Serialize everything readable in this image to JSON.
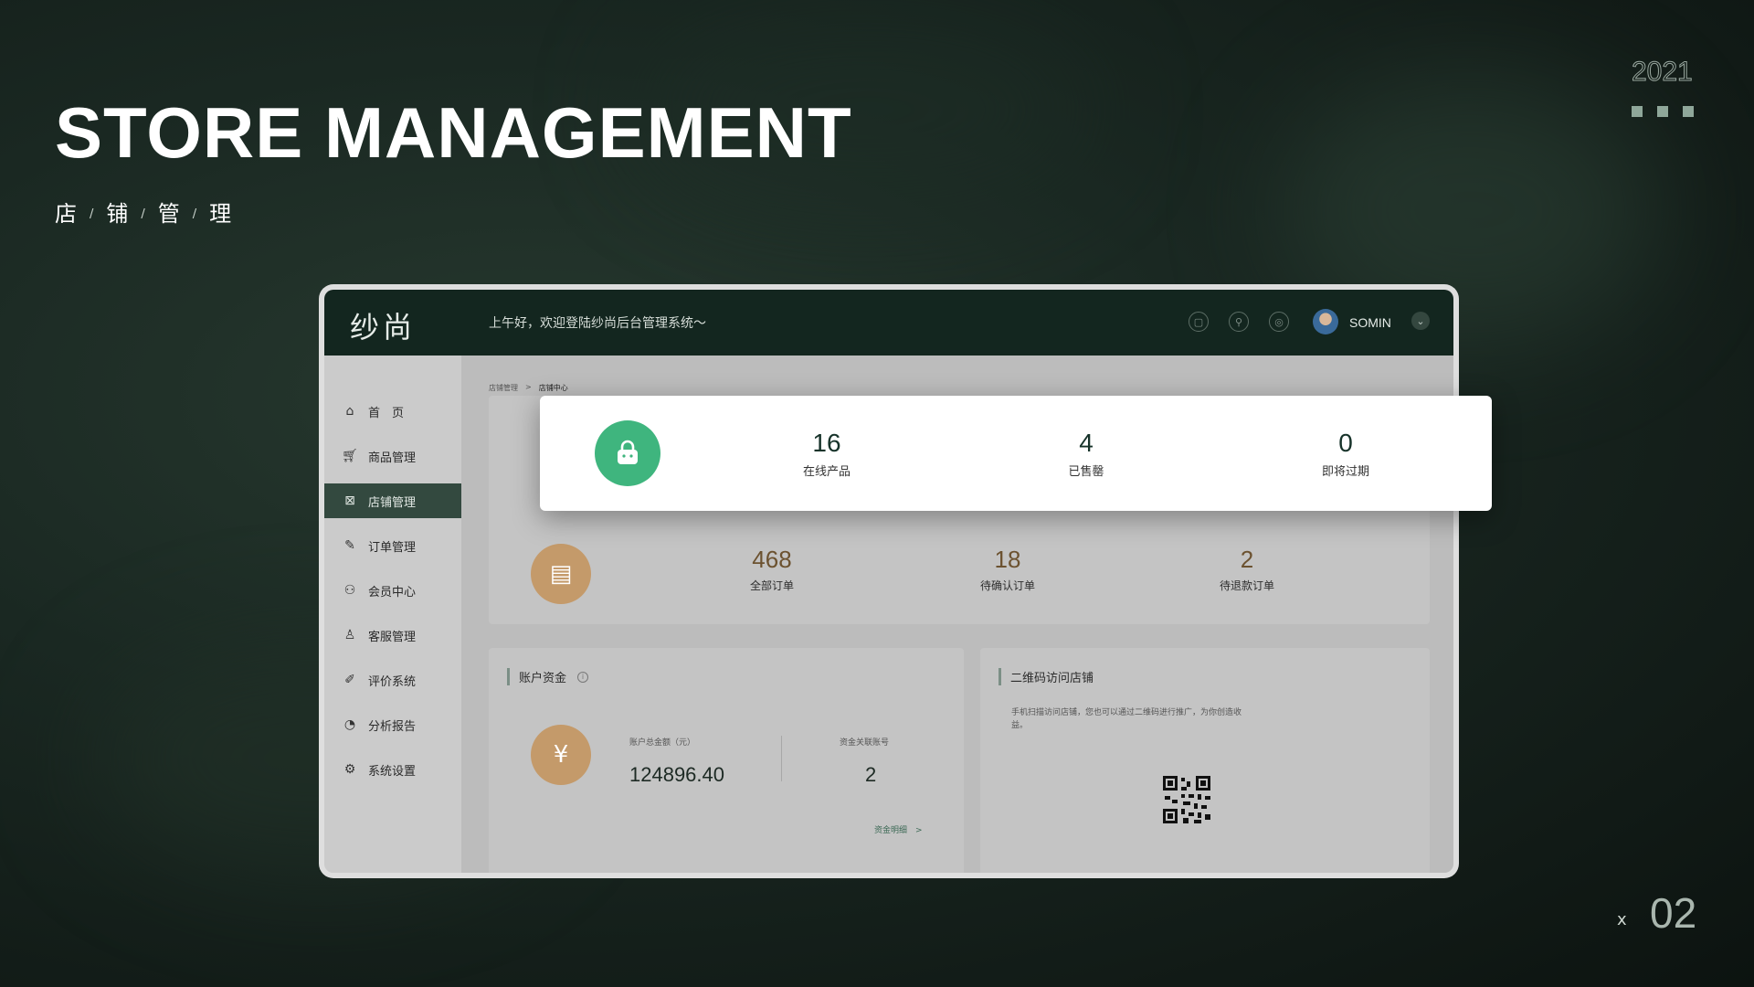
{
  "slide": {
    "title": "STORE MANAGEMENT",
    "subtitle_chars": [
      "店",
      "铺",
      "管",
      "理"
    ],
    "subtitle_sep": "/",
    "year": "2021",
    "page_prefix": "x",
    "page_number": "02"
  },
  "app": {
    "logo": "纱尚",
    "welcome": "上午好，欢迎登陆纱尚后台管理系统～",
    "username": "SOMIN",
    "header_icons": [
      "message-icon",
      "search-icon",
      "settings-icon"
    ]
  },
  "sidebar": {
    "items": [
      {
        "label": "首　页",
        "icon": "home-icon"
      },
      {
        "label": "商品管理",
        "icon": "cart-icon"
      },
      {
        "label": "店铺管理",
        "icon": "store-icon",
        "active": true
      },
      {
        "label": "订单管理",
        "icon": "edit-icon"
      },
      {
        "label": "会员中心",
        "icon": "members-icon"
      },
      {
        "label": "客服管理",
        "icon": "user-icon"
      },
      {
        "label": "评价系统",
        "icon": "pen-icon"
      },
      {
        "label": "分析报告",
        "icon": "chart-icon"
      },
      {
        "label": "系统设置",
        "icon": "gear-icon"
      }
    ]
  },
  "breadcrumb": {
    "parent": "店铺管理",
    "sep": ">",
    "current": "店铺中心"
  },
  "product_stats": [
    {
      "value": "16",
      "label": "在线产品"
    },
    {
      "value": "4",
      "label": "已售罄"
    },
    {
      "value": "0",
      "label": "即将过期"
    }
  ],
  "order_stats": [
    {
      "value": "468",
      "label": "全部订单"
    },
    {
      "value": "18",
      "label": "待确认订单"
    },
    {
      "value": "2",
      "label": "待退款订单"
    }
  ],
  "funds": {
    "title": "账户资金",
    "total_label": "账户总金额（元）",
    "total_value": "124896.40",
    "linked_label": "资金关联账号",
    "linked_value": "2",
    "detail_link": "资金明细　>"
  },
  "qr": {
    "title": "二维码访问店铺",
    "desc": "手机扫描访问店铺，您也可以通过二维码进行推广，为你创造收益。"
  },
  "colors": {
    "topbar": "#13261f",
    "active_nav": "#33493f",
    "accent_green": "#3fb57e",
    "accent_orange": "#c49a6a"
  }
}
